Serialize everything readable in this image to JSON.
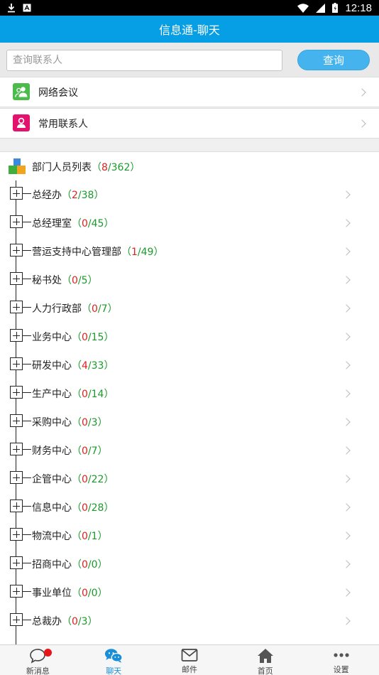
{
  "status_bar": {
    "time": "12:18"
  },
  "title": "信息通-聊天",
  "search": {
    "placeholder": "查询联系人",
    "value": "",
    "button_label": "查询"
  },
  "menu": [
    {
      "label": "网络会议",
      "icon": "meeting-icon",
      "color": "#4bbb4b"
    },
    {
      "label": "常用联系人",
      "icon": "contact-icon",
      "color": "#e2126e"
    }
  ],
  "org": {
    "label": "部门人员列表",
    "count": {
      "open": "（",
      "online": "8",
      "sep": "/",
      "total": "362",
      "close": "）"
    },
    "departments": [
      {
        "name": "总经办",
        "online": "2",
        "total": "38"
      },
      {
        "name": "总经理室",
        "online": "0",
        "total": "45"
      },
      {
        "name": "营运支持中心管理部",
        "online": "1",
        "total": "49"
      },
      {
        "name": "秘书处",
        "online": "0",
        "total": "5"
      },
      {
        "name": "人力行政部",
        "online": "0",
        "total": "7"
      },
      {
        "name": "业务中心",
        "online": "0",
        "total": "15"
      },
      {
        "name": "研发中心",
        "online": "4",
        "total": "33"
      },
      {
        "name": "生产中心",
        "online": "0",
        "total": "14"
      },
      {
        "name": "采购中心",
        "online": "0",
        "total": "3"
      },
      {
        "name": "财务中心",
        "online": "0",
        "total": "7"
      },
      {
        "name": "企管中心",
        "online": "0",
        "total": "22"
      },
      {
        "name": "信息中心",
        "online": "0",
        "total": "28"
      },
      {
        "name": "物流中心",
        "online": "0",
        "total": "1"
      },
      {
        "name": "招商中心",
        "online": "0",
        "total": "0"
      },
      {
        "name": "事业单位",
        "online": "0",
        "total": "0"
      },
      {
        "name": "总裁办",
        "online": "0",
        "total": "3"
      }
    ]
  },
  "tabs": [
    {
      "label": "新消息",
      "icon": "chat-bubble-icon",
      "badge": true,
      "active": false
    },
    {
      "label": "聊天",
      "icon": "chat-group-icon",
      "badge": false,
      "active": true
    },
    {
      "label": "邮件",
      "icon": "mail-icon",
      "badge": false,
      "active": false
    },
    {
      "label": "首页",
      "icon": "home-icon",
      "badge": false,
      "active": false
    },
    {
      "label": "设置",
      "icon": "more-icon",
      "badge": false,
      "active": false
    }
  ],
  "colors": {
    "accent": "#069fe6",
    "button": "#45b4ee",
    "count_green": "#1a9a2a",
    "count_red": "#e02020",
    "badge": "#e8141a"
  }
}
